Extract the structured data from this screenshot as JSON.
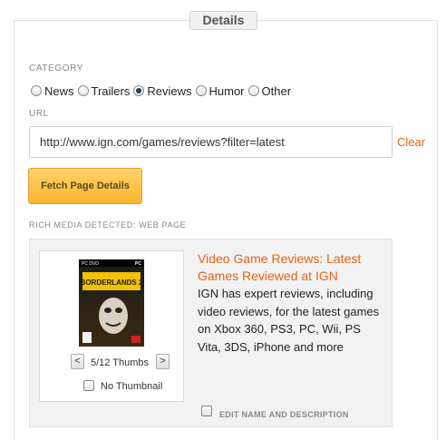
{
  "legend": "Details",
  "category": {
    "label": "CATEGORY",
    "options": [
      "News",
      "Trailers",
      "Reviews",
      "Humor",
      "Other"
    ],
    "selected": "Reviews"
  },
  "url": {
    "label": "URL",
    "value": "http://www.ign.com/games/reviews?filter=latest",
    "clear_label": "Clear"
  },
  "fetch_button": "Fetch Page Details",
  "rich_media": {
    "label": "RICH MEDIA DETECTED: WEB PAGE",
    "title": "Video Game Reviews: Latest Games Reviewed at IGN",
    "description": "IGN has expert reviews, including video reviews, for the latest games on Xbox 360, PS3, PC, Wii, PS Vita, 3DS, iPhone and more",
    "thumb_counter": "5/12 Thumbs",
    "prev_symbol": "<",
    "next_symbol": ">",
    "no_thumbnail_label": "No Thumbnail",
    "no_thumbnail_checked": false,
    "edit_label": "EDIT NAME AND DESCRIPTION",
    "edit_checked": false,
    "thumbnail_icon": "game-cover-image",
    "thumbnail_text": {
      "platform": "PC",
      "dvd": "PC DVD",
      "title": "BORDERLANDS 2"
    }
  },
  "colors": {
    "link_orange": "#e0651c",
    "button_gold": "#f9b52d",
    "panel_gray": "#f2f2f2"
  }
}
